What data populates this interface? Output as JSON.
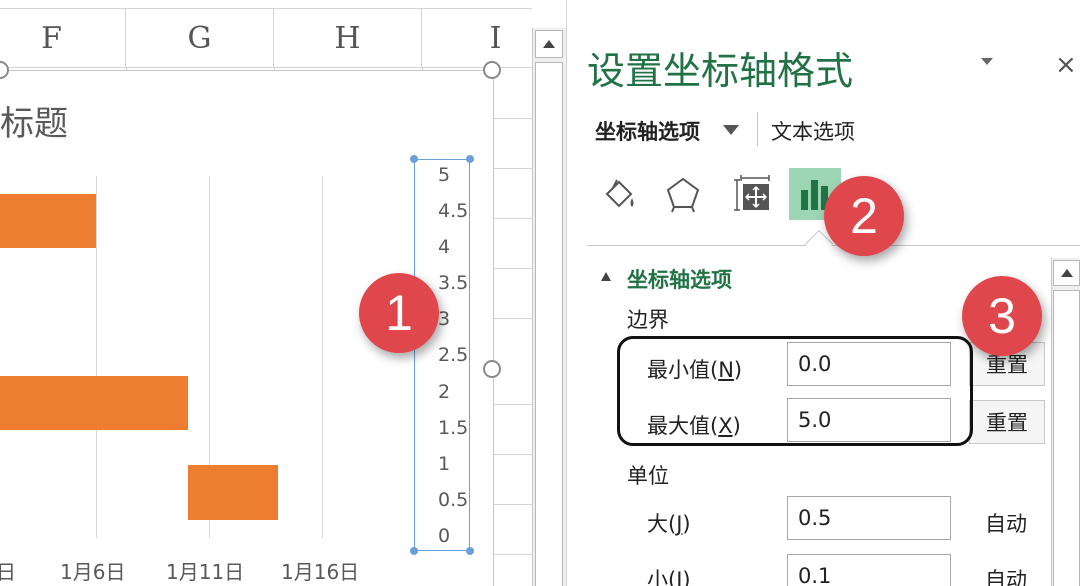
{
  "sheet": {
    "columns": [
      "F",
      "G",
      "H",
      "I"
    ],
    "chart": {
      "title": "标题",
      "x_ticks": [
        "日",
        "1月6日",
        "1月11日",
        "1月16日"
      ],
      "y_ticks": [
        "5",
        "4.5",
        "4",
        "3.5",
        "3",
        "2.5",
        "2",
        "1.5",
        "1",
        "0.5",
        "0"
      ]
    }
  },
  "chart_data": {
    "type": "bar",
    "title": "标题",
    "orientation": "horizontal",
    "x_tick_labels": [
      "日",
      "1月6日",
      "1月11日",
      "1月16日"
    ],
    "y_tick_labels": [
      "5",
      "4.5",
      "4",
      "3.5",
      "3",
      "2.5",
      "2",
      "1.5",
      "1",
      "0.5",
      "0"
    ],
    "ylim": [
      0,
      5
    ],
    "grid": true,
    "color": "#ed7d31",
    "bars": [
      {
        "y": 4.5,
        "end": "1月6日"
      },
      {
        "y": 2.5,
        "end": "1月11日"
      },
      {
        "y": 1,
        "start": "1月11日",
        "end": "1月16日"
      }
    ]
  },
  "pane": {
    "title": "设置坐标轴格式",
    "close": "×",
    "tabs": {
      "axis_options": "坐标轴选项",
      "text_options": "文本选项"
    },
    "icons": [
      "fill-line-icon",
      "effects-pentagon-icon",
      "size-properties-icon",
      "axis-options-bar-icon"
    ],
    "section": "坐标轴选项",
    "bounds": {
      "label": "边界",
      "min_label": "最小值(",
      "min_key": "N",
      "min_value": "0.0",
      "max_label": "最大值(",
      "max_key": "X",
      "max_value": "5.0",
      "reset": "重置"
    },
    "units": {
      "label": "单位",
      "major_label": "大(",
      "major_key": "J",
      "major_value": "0.5",
      "minor_label": "小(",
      "minor_key": "I",
      "minor_value": "0.1",
      "auto": "自动"
    },
    "close_paren": ")"
  },
  "callouts": [
    "1",
    "2",
    "3"
  ],
  "colors": {
    "accent_green": "#217346",
    "bar_orange": "#ed7d31",
    "badge_red": "#e0474c",
    "selection_blue": "#6aa0d8"
  }
}
